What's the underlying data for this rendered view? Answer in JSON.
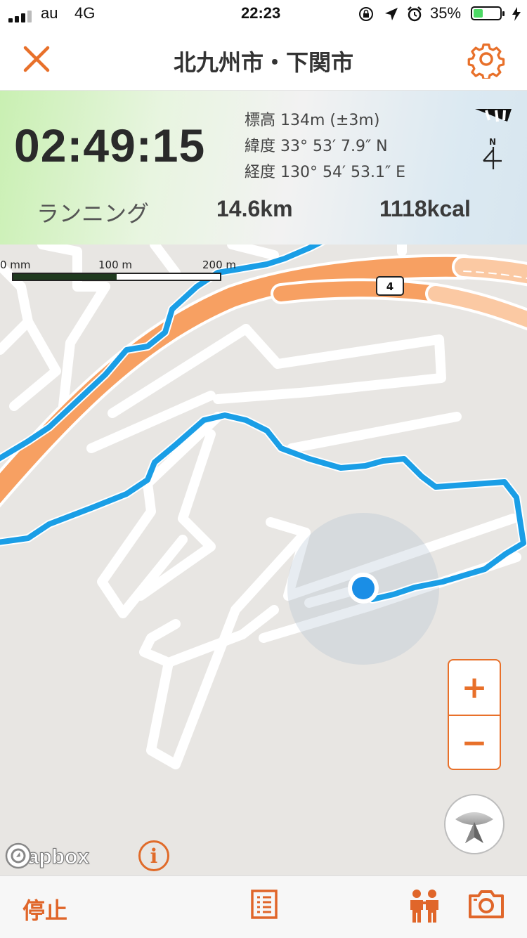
{
  "status_bar": {
    "carrier": "au",
    "network": "4G",
    "time": "22:23",
    "battery_percent": "35%",
    "battery_level": 0.35
  },
  "nav": {
    "title": "北九州市・下関市",
    "close_icon": "close-icon",
    "settings_icon": "gear-icon"
  },
  "stats": {
    "elapsed_time": "02:49:15",
    "altitude": "標高 134m (±3m)",
    "latitude": "緯度 33° 53′ 7.9″ N",
    "longitude": "経度 130° 54′ 53.1″ E",
    "compass_label": "N",
    "activity": "ランニング",
    "distance": "14.6km",
    "calories": "1118kcal"
  },
  "map": {
    "scale_labels": [
      "0 mm",
      "100 m",
      "200 m"
    ],
    "road_number": "4",
    "zoom_in_label": "+",
    "zoom_out_label": "−",
    "attribution": "mapbox",
    "info_label": "i",
    "route_color": "#1a9ee6",
    "highway_color": "#f7a062"
  },
  "bottom_bar": {
    "stop_label": "停止",
    "list_icon": "list-icon",
    "people_icon": "people-icon",
    "camera_icon": "camera-icon"
  },
  "colors": {
    "accent": "#e8702a"
  }
}
